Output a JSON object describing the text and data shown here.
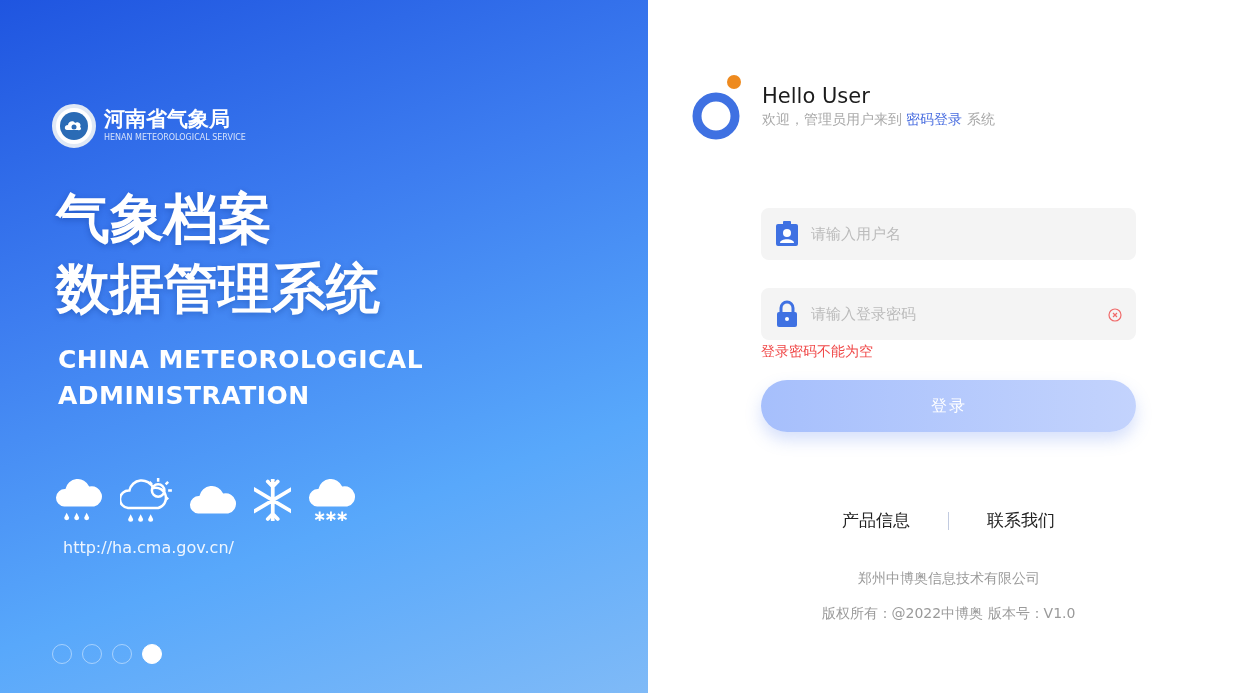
{
  "banner": {
    "logo_title": "河南省气象局",
    "logo_subtitle": "HENAN METEOROLOGICAL SERVICE",
    "headline": [
      "气象档案",
      "数据管理系统"
    ],
    "subtitle": [
      "CHINA METEOROLOGICAL",
      "ADMINISTRATION"
    ],
    "weather_icons": [
      {
        "kind": "rain"
      },
      {
        "kind": "sun-rain"
      },
      {
        "kind": "cloud"
      },
      {
        "kind": "snowflake"
      },
      {
        "kind": "snow"
      }
    ],
    "url": "http://ha.cma.gov.cn/",
    "carousel": [
      {
        "selected": false
      },
      {
        "selected": false
      },
      {
        "selected": false
      },
      {
        "selected": true
      }
    ]
  },
  "login": {
    "greeting": "Hello User",
    "welcome": {
      "before": "欢迎，管理员用户来到",
      "link": "密码登录",
      "after": "系统"
    },
    "username": {
      "placeholder": "请输入用户名"
    },
    "password": {
      "placeholder": "请输入登录密码",
      "error": "登录密码不能为空"
    },
    "submit": {
      "label": "登录",
      "disabled": true
    }
  },
  "footer": {
    "links": [
      "产品信息",
      "联系我们"
    ],
    "company": "郑州中博奥信息技术有限公司",
    "copyright": "版权所有：@2022中博奥 版本号：V1.0"
  }
}
